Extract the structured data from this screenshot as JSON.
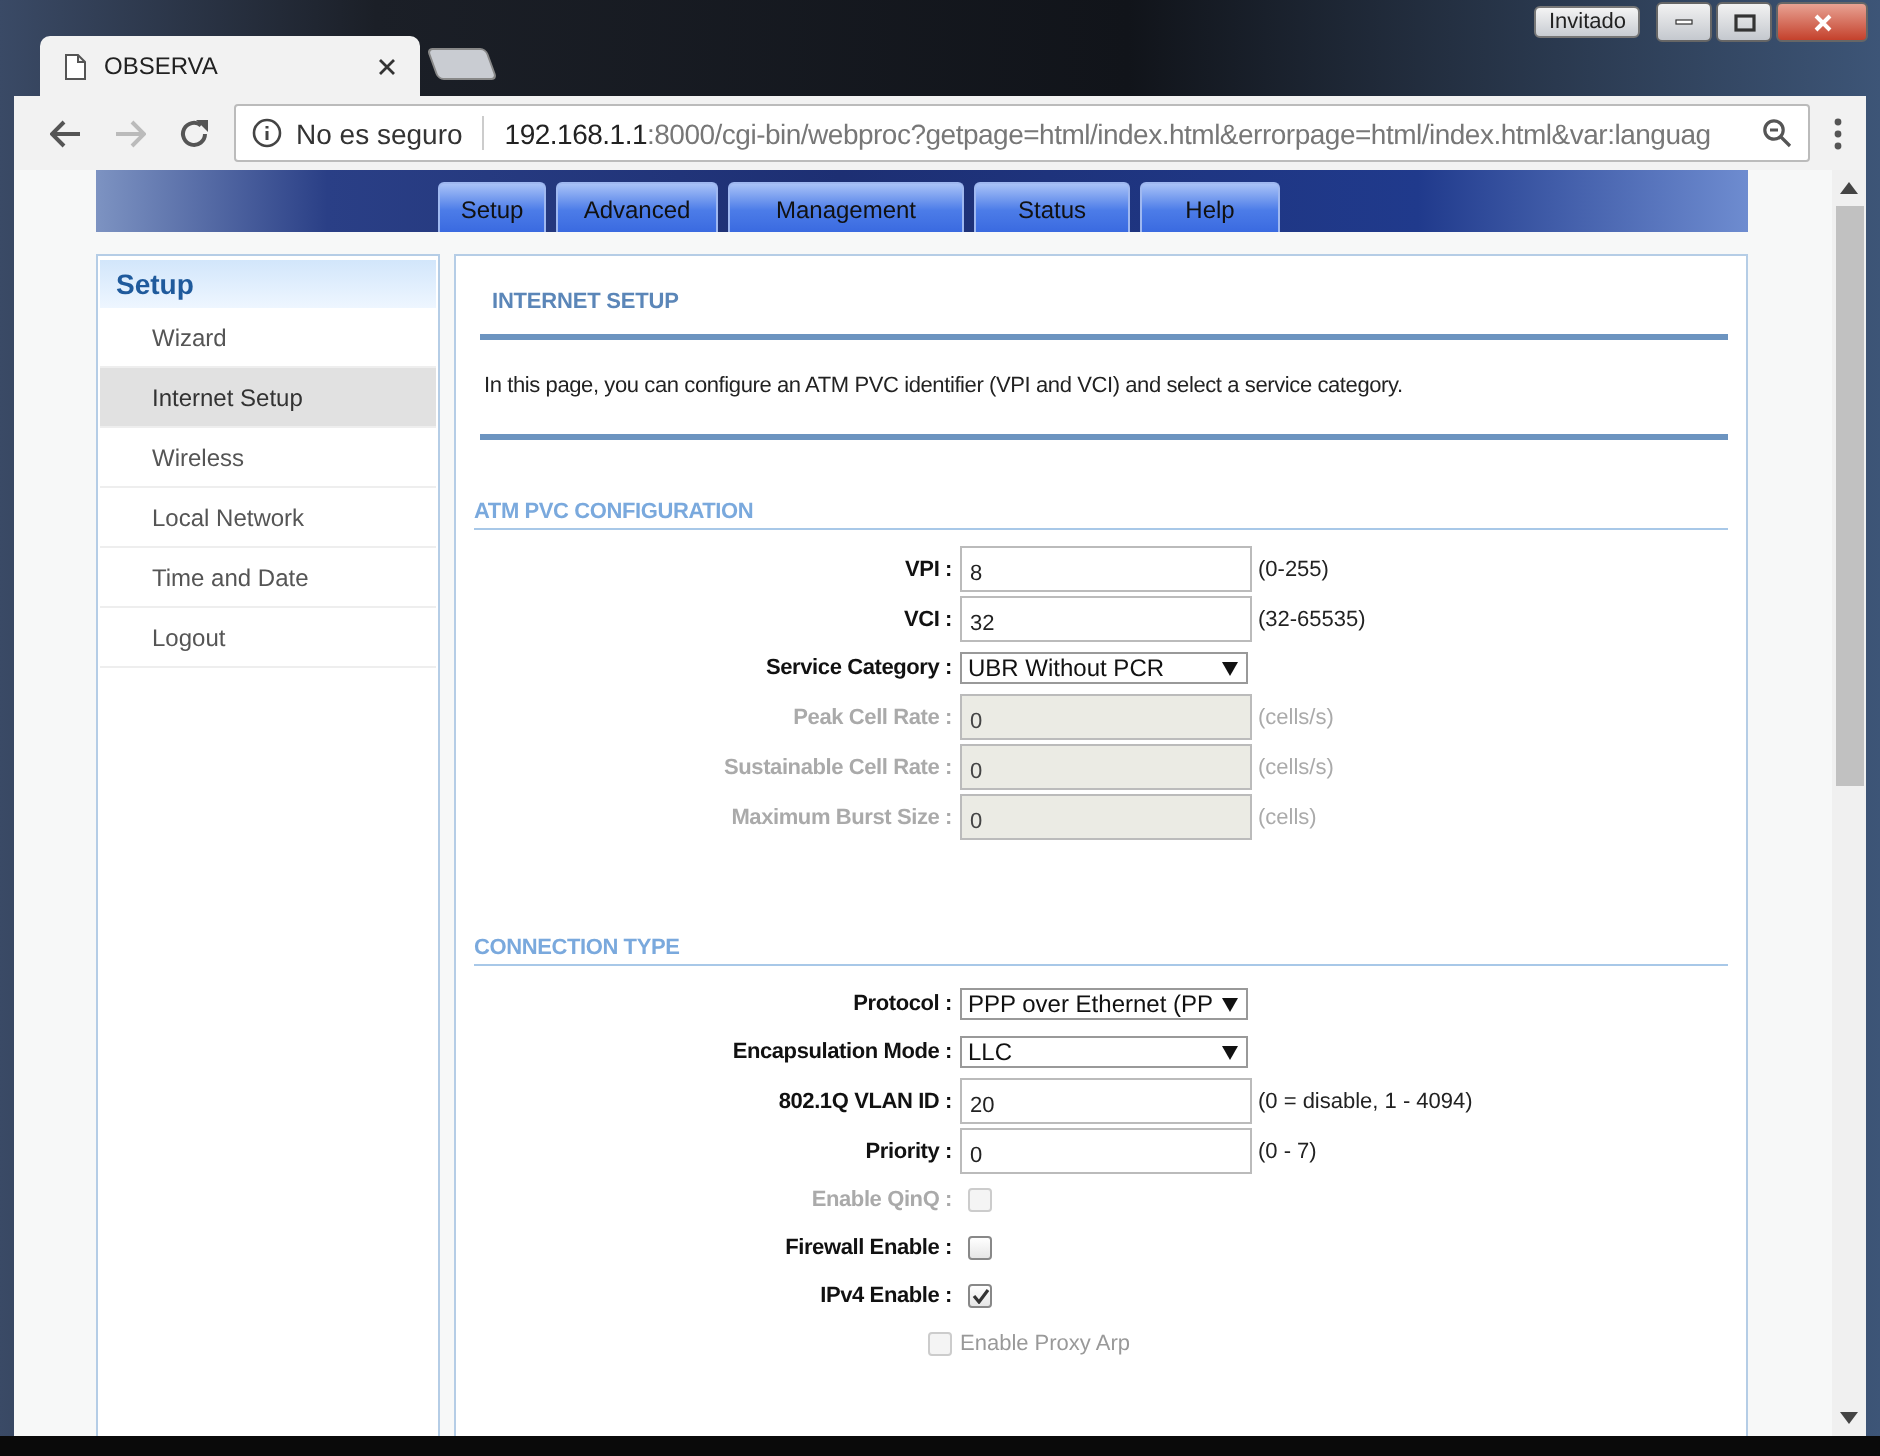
{
  "browser": {
    "tab_title": "OBSERVA",
    "profile": "Invitado",
    "security": "No es seguro",
    "url_host": "192.168.1.1",
    "url_rest": ":8000/cgi-bin/webproc?getpage=html/index.html&errorpage=html/index.html&var:languag"
  },
  "nav_tabs": [
    {
      "label": "Setup"
    },
    {
      "label": "Advanced"
    },
    {
      "label": "Management"
    },
    {
      "label": "Status"
    },
    {
      "label": "Help"
    }
  ],
  "sidebar": {
    "title": "Setup",
    "items": [
      {
        "label": "Wizard",
        "selected": false
      },
      {
        "label": "Internet Setup",
        "selected": true
      },
      {
        "label": "Wireless",
        "selected": false
      },
      {
        "label": "Local Network",
        "selected": false
      },
      {
        "label": "Time and Date",
        "selected": false
      },
      {
        "label": "Logout",
        "selected": false
      }
    ]
  },
  "page": {
    "title": "INTERNET SETUP",
    "intro": "In this page, you can configure an ATM PVC identifier (VPI and VCI) and select a service category.",
    "sections": [
      {
        "title": "ATM PVC CONFIGURATION",
        "fields": [
          {
            "kind": "text",
            "label": "VPI :",
            "value": "8",
            "hint": "(0-255)",
            "disabled": false
          },
          {
            "kind": "text",
            "label": "VCI :",
            "value": "32",
            "hint": "(32-65535)",
            "disabled": false
          },
          {
            "kind": "select",
            "label": "Service Category :",
            "value": "UBR Without PCR",
            "disabled": false
          },
          {
            "kind": "text",
            "label": "Peak Cell Rate :",
            "value": "0",
            "hint": "(cells/s)",
            "disabled": true
          },
          {
            "kind": "text",
            "label": "Sustainable Cell Rate :",
            "value": "0",
            "hint": "(cells/s)",
            "disabled": true
          },
          {
            "kind": "text",
            "label": "Maximum Burst Size :",
            "value": "0",
            "hint": "(cells)",
            "disabled": true
          }
        ]
      },
      {
        "title": "CONNECTION TYPE",
        "fields": [
          {
            "kind": "select",
            "label": "Protocol :",
            "value": "PPP over Ethernet (PP",
            "disabled": false
          },
          {
            "kind": "select",
            "label": "Encapsulation Mode :",
            "value": "LLC",
            "disabled": false
          },
          {
            "kind": "text",
            "label": "802.1Q VLAN ID :",
            "value": "20",
            "hint": "(0 = disable, 1 - 4094)",
            "disabled": false
          },
          {
            "kind": "text",
            "label": "Priority :",
            "value": "0",
            "hint": "(0 - 7)",
            "disabled": false
          },
          {
            "kind": "checkbox",
            "label": "Enable QinQ :",
            "checked": false,
            "disabled": true
          },
          {
            "kind": "checkbox",
            "label": "Firewall Enable :",
            "checked": false,
            "disabled": false
          },
          {
            "kind": "checkbox",
            "label": "IPv4 Enable :",
            "checked": true,
            "disabled": false
          },
          {
            "kind": "checkbox-after",
            "label": "Enable Proxy Arp",
            "checked": false,
            "disabled": true
          }
        ]
      }
    ]
  }
}
